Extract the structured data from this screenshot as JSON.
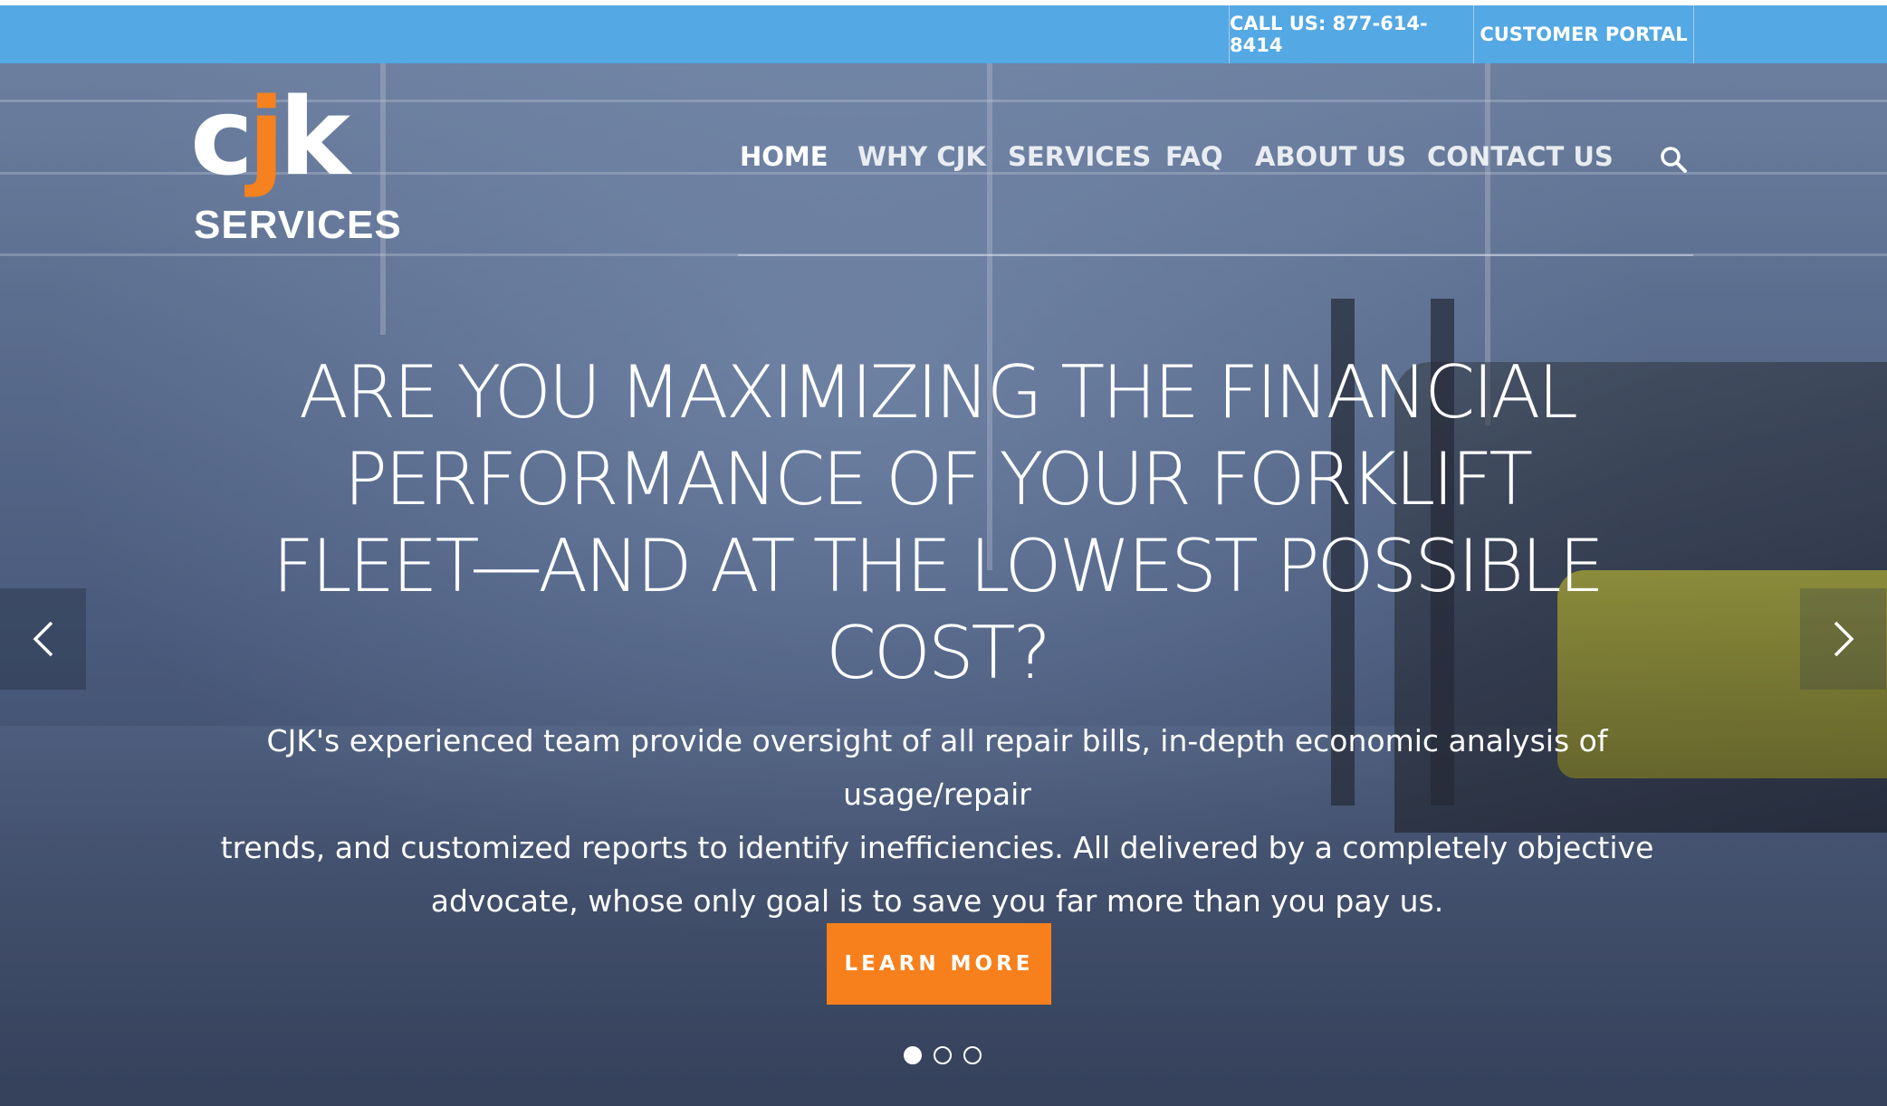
{
  "topbar": {
    "call_label": "CALL US: 877-614-8414",
    "portal_label": "CUSTOMER PORTAL"
  },
  "logo": {
    "letters_c": "c",
    "letters_j": "j",
    "letters_k": "k",
    "services": "SERVICES"
  },
  "nav": {
    "items": [
      {
        "label": "HOME",
        "active": true
      },
      {
        "label": "WHY CJK"
      },
      {
        "label": "SERVICES"
      },
      {
        "label": "FAQ"
      },
      {
        "label": "ABOUT US"
      },
      {
        "label": "CONTACT US"
      }
    ],
    "search_icon": "search-icon"
  },
  "hero": {
    "headline_lines": [
      "ARE YOU MAXIMIZING THE FINANCIAL",
      "PERFORMANCE OF YOUR FORKLIFT",
      "FLEET—AND AT THE LOWEST POSSIBLE",
      "COST?"
    ],
    "subtext_lines": [
      "CJK's experienced team provide oversight of all repair bills, in-depth economic analysis of usage/repair",
      "trends, and customized reports to identify inefficiencies. All delivered by a completely objective",
      "advocate, whose only goal is to save you far more than you pay us."
    ],
    "cta_label": "LEARN MORE",
    "slides_total": 3,
    "active_slide": 1
  },
  "colors": {
    "topbar": "#54a8e3",
    "cta": "#f7801d",
    "logo_accent": "#f5821f"
  }
}
